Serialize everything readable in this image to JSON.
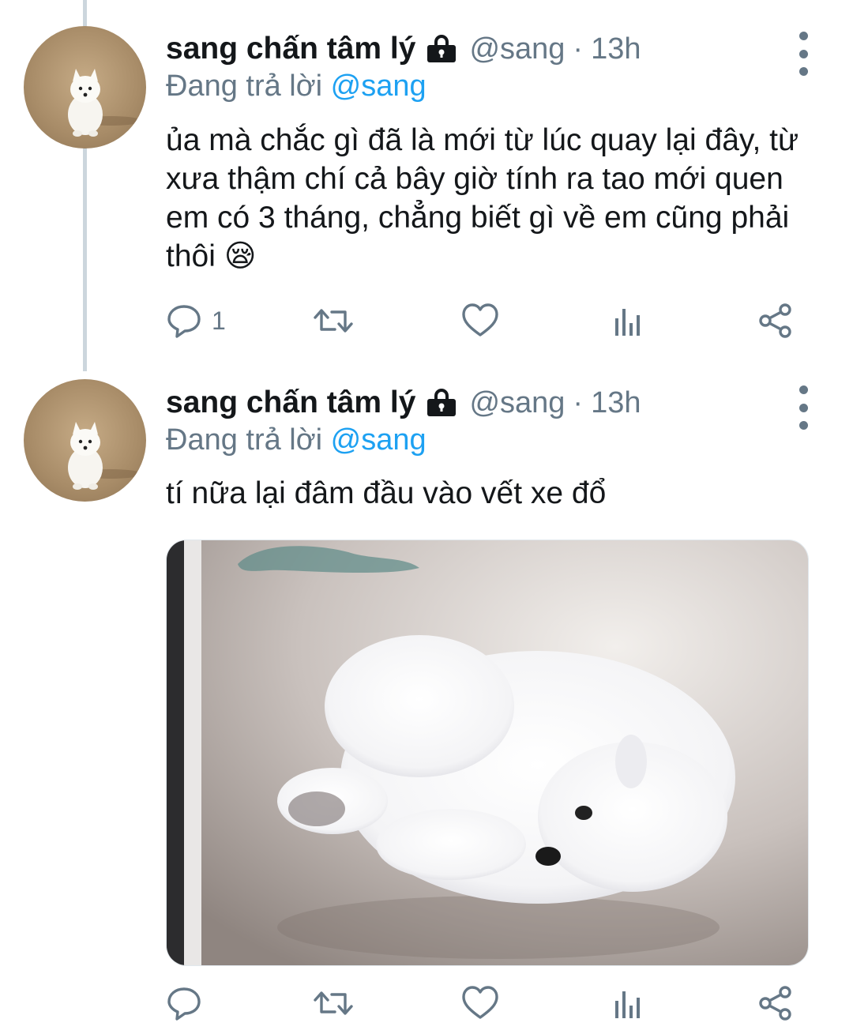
{
  "tweets": [
    {
      "name": "sang chấn tâm lý",
      "handle": "@sang",
      "dot": "·",
      "time": "13h",
      "replying_prefix": "Đang trả lời",
      "replying_to": "@sang",
      "text": "ủa mà chắc gì đã là mới từ lúc quay lại đây, từ xưa thậm chí cả bây giờ tính ra tao mới quen em có 3 tháng, chẳng biết gì về em cũng phải thôi 😪",
      "reply_count": "1",
      "icons": [
        "lock-icon",
        "reply-icon",
        "retweet-icon",
        "like-icon",
        "analytics-icon",
        "share-icon",
        "more-icon"
      ]
    },
    {
      "name": "sang chấn tâm lý",
      "handle": "@sang",
      "dot": "·",
      "time": "13h",
      "replying_prefix": "Đang trả lời",
      "replying_to": "@sang",
      "text": "tí nữa lại đâm đầu vào vết xe đổ",
      "reply_count": "",
      "has_media": true,
      "icons": [
        "lock-icon",
        "reply-icon",
        "retweet-icon",
        "like-icon",
        "analytics-icon",
        "share-icon",
        "more-icon"
      ]
    }
  ],
  "colors": {
    "text": "#14171a",
    "secondary": "#657786",
    "mention": "#1da1f2",
    "thread_line": "#ccd6dd"
  }
}
